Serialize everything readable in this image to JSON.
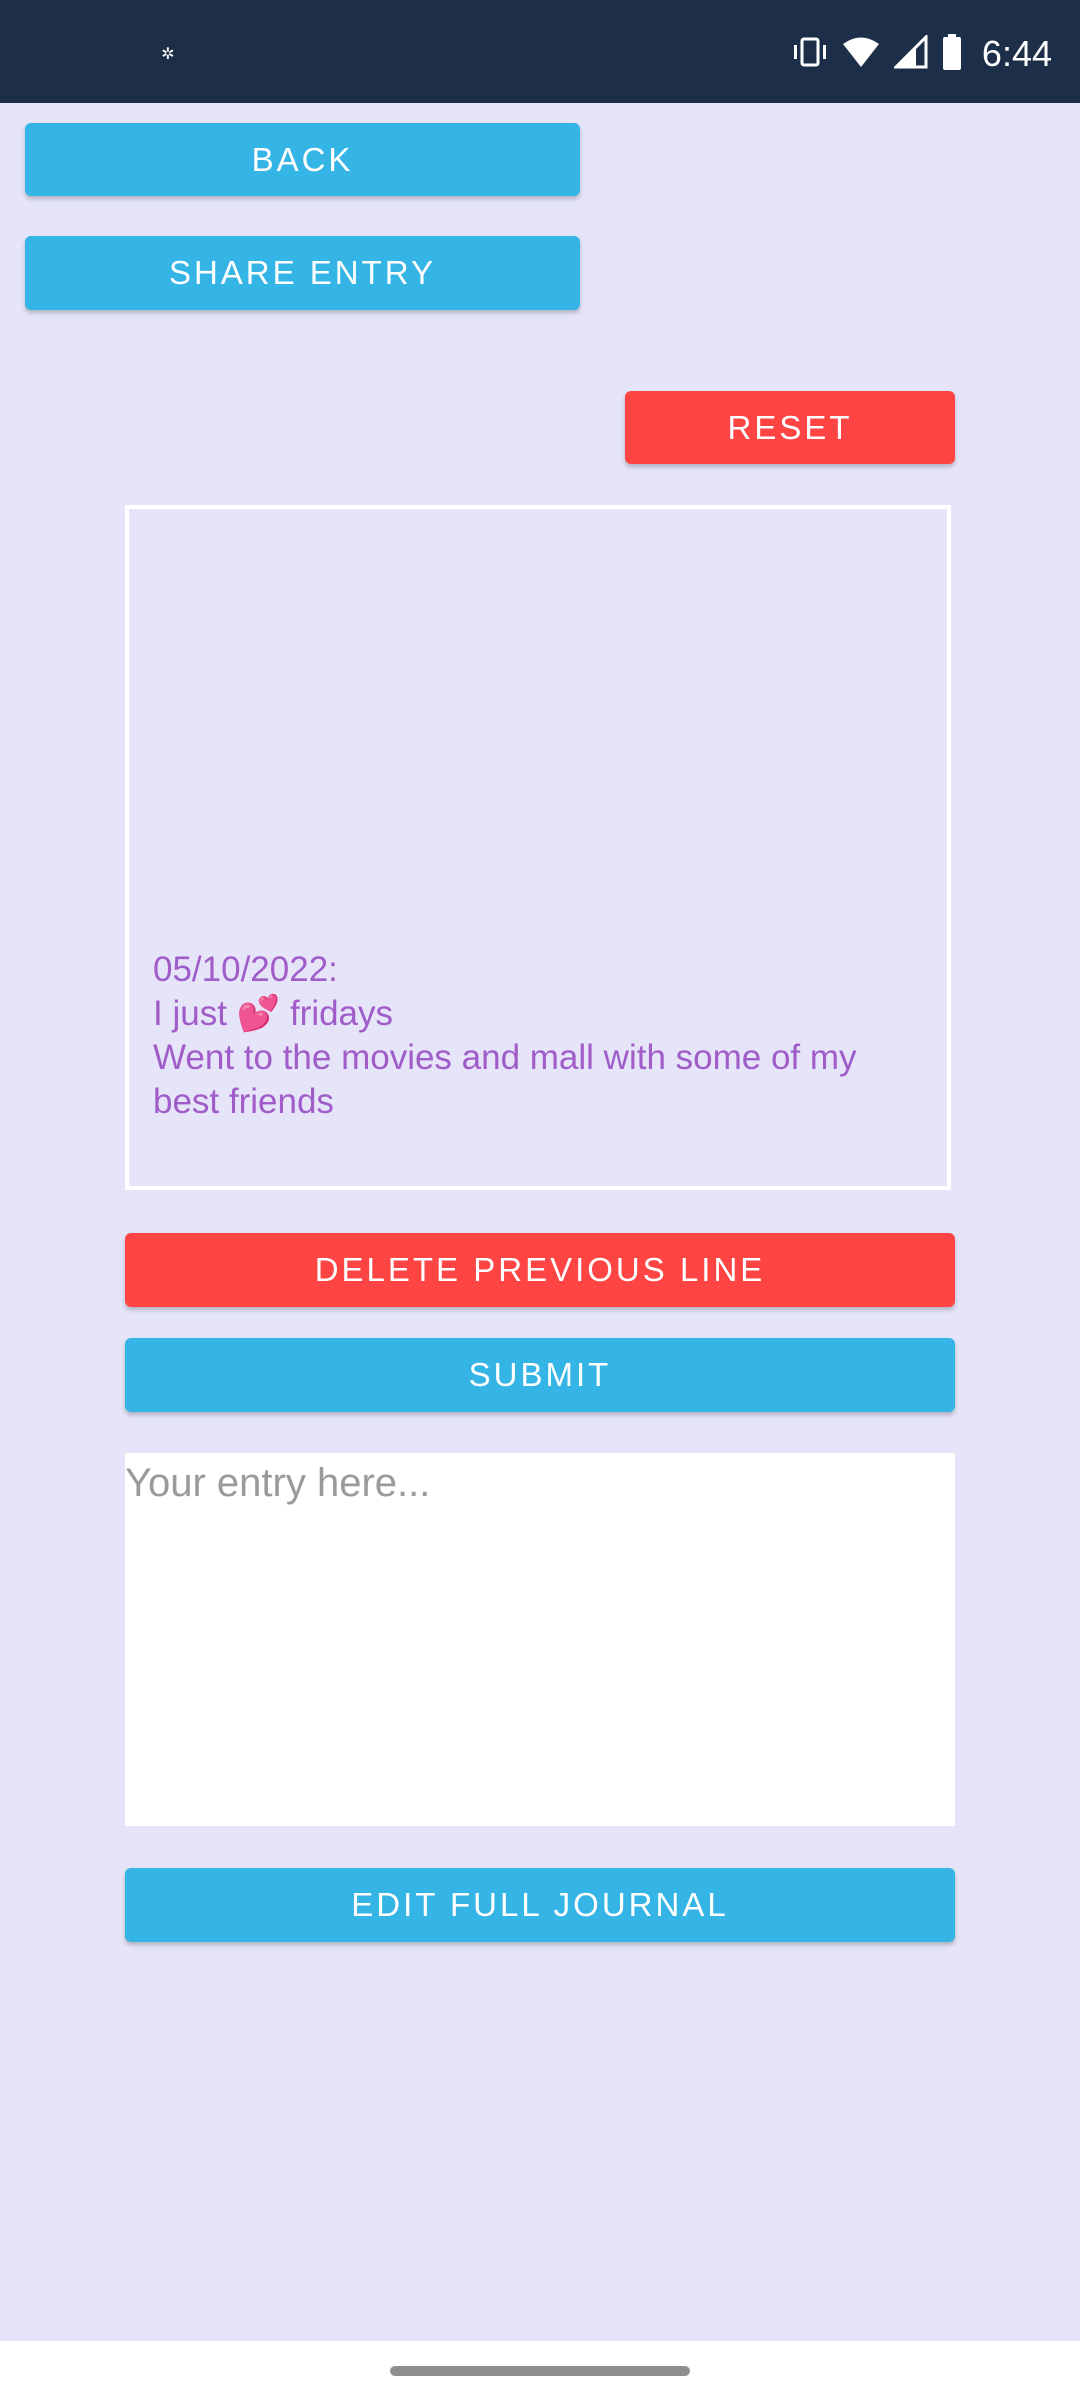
{
  "status_bar": {
    "time": "6:44",
    "icons": [
      "vibrate-icon",
      "wifi-icon",
      "signal-icon",
      "battery-icon"
    ]
  },
  "toolbar": {
    "back_label": "Back",
    "share_label": "Share Entry",
    "reset_label": "Reset"
  },
  "journal": {
    "lines": [
      "05/10/2022:",
      "I just 💕 fridays",
      "Went to the movies and mall with some of my best friends"
    ]
  },
  "actions": {
    "delete_label": "Delete Previous Line",
    "submit_label": "Submit",
    "edit_label": "Edit Full Journal"
  },
  "entry": {
    "placeholder": "Your entry here...",
    "value": ""
  },
  "colors": {
    "background": "#E5E4F8",
    "status_bar": "#1D2F48",
    "primary_button": "#35B4E6",
    "danger_button": "#FF4444",
    "journal_text": "#A05CC8"
  }
}
